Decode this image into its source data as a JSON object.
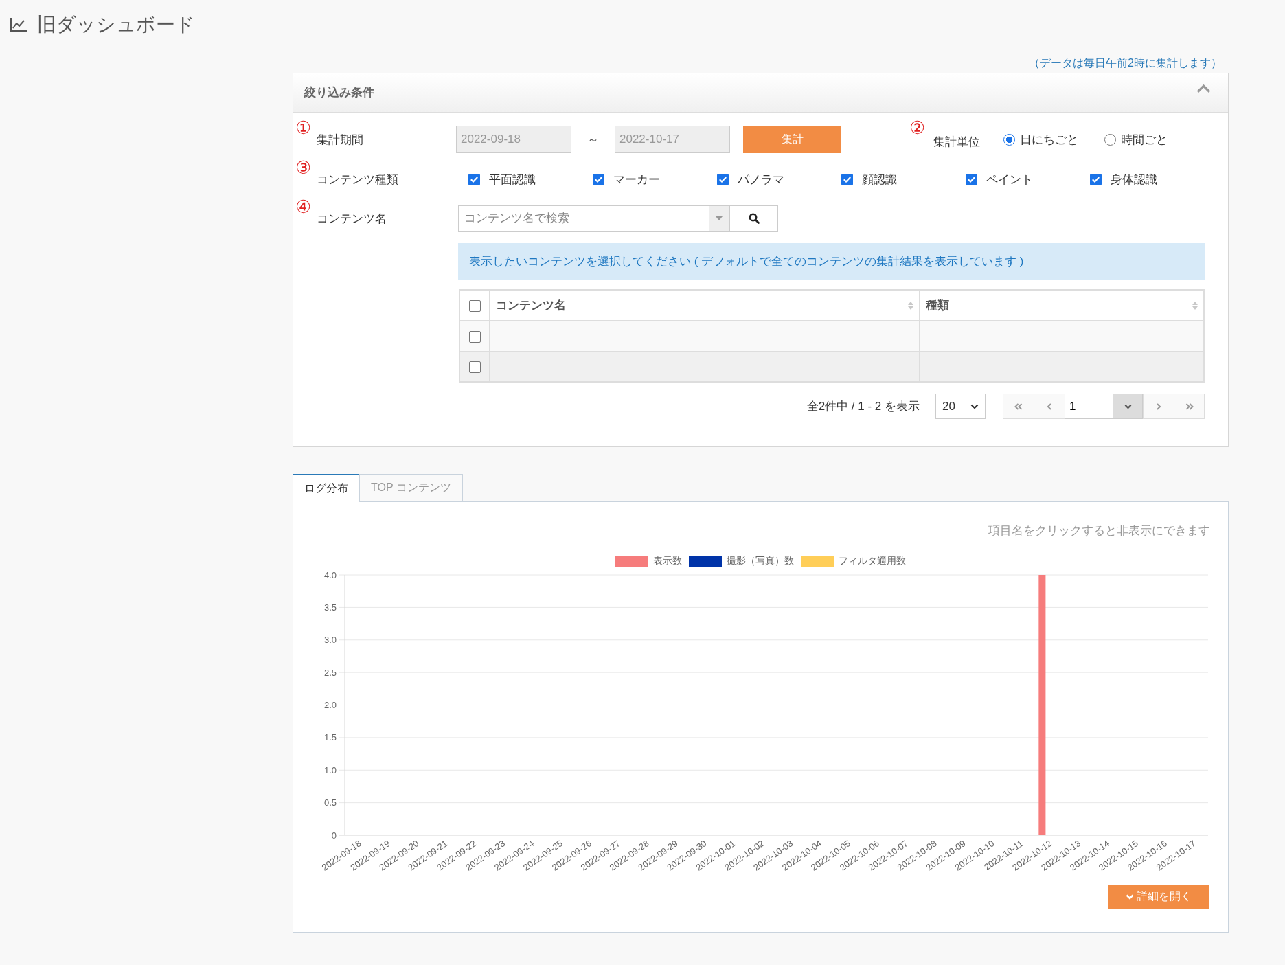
{
  "header": {
    "title": "旧ダッシュボード"
  },
  "note": "（データは毎日午前2時に集計します）",
  "filter_panel": {
    "title": "絞り込み条件",
    "expanded": true,
    "period": {
      "number": "①",
      "label": "集計期間",
      "from": "2022-09-18",
      "separator": "～",
      "to": "2022-10-17",
      "disabled": true,
      "button": "集計"
    },
    "unit": {
      "number": "②",
      "label": "集計単位",
      "options": [
        {
          "label": "日にちごと",
          "selected": true
        },
        {
          "label": "時間ごと",
          "selected": false
        }
      ]
    },
    "content_types": {
      "number": "③",
      "label": "コンテンツ種類",
      "options": [
        {
          "label": "平面認識",
          "checked": true
        },
        {
          "label": "マーカー",
          "checked": true
        },
        {
          "label": "パノラマ",
          "checked": true
        },
        {
          "label": "顔認識",
          "checked": true
        },
        {
          "label": "ペイント",
          "checked": true
        },
        {
          "label": "身体認識",
          "checked": true
        }
      ]
    },
    "content_name": {
      "number": "④",
      "label": "コンテンツ名",
      "placeholder": "コンテンツ名で検索"
    },
    "info": "表示したいコンテンツを選択してください ( デフォルトで全てのコンテンツの集計結果を表示しています )",
    "table": {
      "all_checked": false,
      "columns": [
        {
          "label": "コンテンツ名"
        },
        {
          "label": "種類"
        }
      ],
      "rows": [
        {
          "checked": false
        },
        {
          "checked": false
        }
      ]
    },
    "pagination": {
      "summary": "全2件中 / 1 - 2 を表示",
      "page_size": "20",
      "page": "1"
    }
  },
  "tabs": [
    {
      "label": "ログ分布",
      "selected": true
    },
    {
      "label": "TOP コンテンツ",
      "selected": false
    }
  ],
  "chart_panel": {
    "hint": "項目名をクリックすると非表示にできます",
    "chart_data": {
      "type": "bar",
      "categories": [
        "2022-09-18",
        "2022-09-19",
        "2022-09-20",
        "2022-09-21",
        "2022-09-22",
        "2022-09-23",
        "2022-09-24",
        "2022-09-25",
        "2022-09-26",
        "2022-09-27",
        "2022-09-28",
        "2022-09-29",
        "2022-09-30",
        "2022-10-01",
        "2022-10-02",
        "2022-10-03",
        "2022-10-04",
        "2022-10-05",
        "2022-10-06",
        "2022-10-07",
        "2022-10-08",
        "2022-10-09",
        "2022-10-10",
        "2022-10-11",
        "2022-10-12",
        "2022-10-13",
        "2022-10-14",
        "2022-10-15",
        "2022-10-16",
        "2022-10-17"
      ],
      "series": [
        {
          "name": "表示数",
          "color": "#f67c7c",
          "values": [
            0,
            0,
            0,
            0,
            0,
            0,
            0,
            0,
            0,
            0,
            0,
            0,
            0,
            0,
            0,
            0,
            0,
            0,
            0,
            0,
            0,
            0,
            0,
            0,
            4,
            0,
            0,
            0,
            0,
            0
          ]
        },
        {
          "name": "撮影（写真）数",
          "color": "#0033a8",
          "values": [
            0,
            0,
            0,
            0,
            0,
            0,
            0,
            0,
            0,
            0,
            0,
            0,
            0,
            0,
            0,
            0,
            0,
            0,
            0,
            0,
            0,
            0,
            0,
            0,
            0,
            0,
            0,
            0,
            0,
            0
          ]
        },
        {
          "name": "フィルタ適用数",
          "color": "#ffce58",
          "values": [
            0,
            0,
            0,
            0,
            0,
            0,
            0,
            0,
            0,
            0,
            0,
            0,
            0,
            0,
            0,
            0,
            0,
            0,
            0,
            0,
            0,
            0,
            0,
            0,
            0,
            0,
            0,
            0,
            0,
            0
          ]
        }
      ],
      "ylim": [
        0,
        4
      ],
      "yticks": [
        0,
        0.5,
        {
          "value": 1,
          "label": "1.0"
        },
        1.5,
        {
          "value": 2,
          "label": "2.0"
        },
        2.5,
        {
          "value": 3,
          "label": "3.0"
        },
        3.5,
        {
          "value": 4,
          "label": "4.0"
        }
      ],
      "grid": true
    },
    "details_button": "詳細を開く"
  }
}
